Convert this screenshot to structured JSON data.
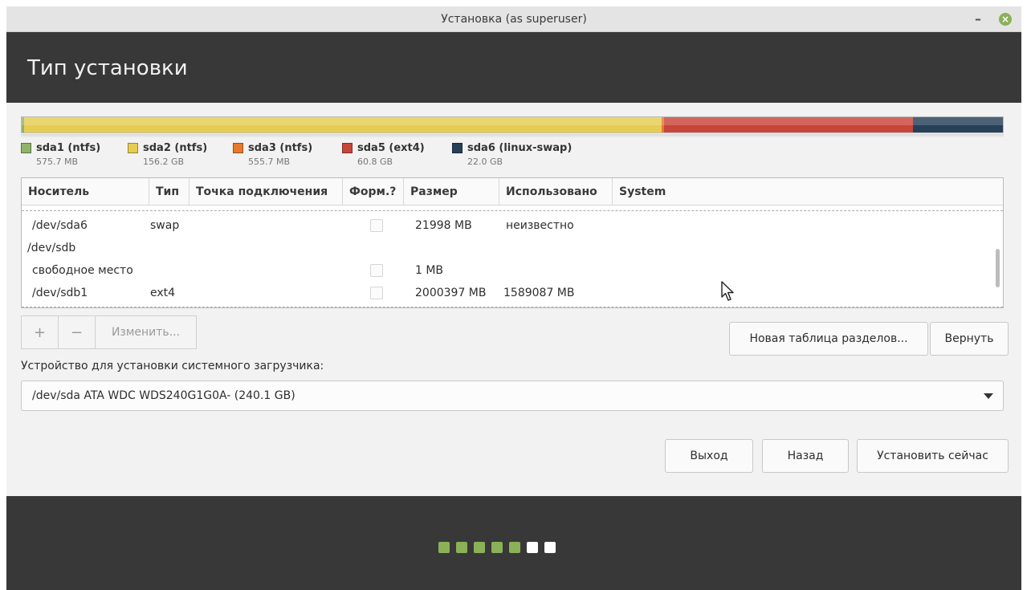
{
  "window": {
    "title": "Установка (as superuser)",
    "minimize_glyph": "–",
    "close_glyph": "×"
  },
  "header": {
    "title": "Тип установки"
  },
  "partition_bar": [
    {
      "id": "sda1",
      "fraction": 0.0024,
      "color": "#8fb36a"
    },
    {
      "id": "sda2",
      "fraction": 0.6502,
      "color": "#e6cd52"
    },
    {
      "id": "sda3",
      "fraction": 0.0023,
      "color": "#e8792c"
    },
    {
      "id": "sda5",
      "fraction": 0.2531,
      "color": "#c8453a"
    },
    {
      "id": "sda6",
      "fraction": 0.092,
      "color": "#26405a"
    }
  ],
  "legend": [
    {
      "name": "sda1 (ntfs)",
      "size": "575.7 MB",
      "color": "#8fb36a"
    },
    {
      "name": "sda2 (ntfs)",
      "size": "156.2 GB",
      "color": "#e6cd52"
    },
    {
      "name": "sda3 (ntfs)",
      "size": "555.7 MB",
      "color": "#e8792c"
    },
    {
      "name": "sda5 (ext4)",
      "size": "60.8 GB",
      "color": "#c8453a"
    },
    {
      "name": "sda6 (linux-swap)",
      "size": "22.0 GB",
      "color": "#26405a"
    }
  ],
  "table": {
    "columns": [
      "Носитель",
      "Тип",
      "Точка подключения",
      "Форм.?",
      "Размер",
      "Использовано",
      "System"
    ],
    "rows": [
      {
        "device": "/dev/sda6",
        "type": "swap",
        "mount": "",
        "format": false,
        "size": "21998 MB",
        "used": "неизвестно",
        "system": ""
      },
      {
        "device": "/dev/sdb",
        "type": "",
        "mount": "",
        "format": null,
        "size": "",
        "used": "",
        "system": ""
      },
      {
        "device": "свободное место",
        "type": "",
        "mount": "",
        "format": false,
        "size": "1 MB",
        "used": "",
        "system": ""
      },
      {
        "device": "/dev/sdb1",
        "type": "ext4",
        "mount": "",
        "format": false,
        "size": "2000397 MB",
        "used": "1589087 MB",
        "system": ""
      }
    ]
  },
  "toolbar": {
    "add_label": "+",
    "remove_label": "−",
    "change_label": "Изменить...",
    "new_table_label": "Новая таблица разделов...",
    "revert_label": "Вернуть"
  },
  "bootloader": {
    "label": "Устройство для установки системного загрузчика:",
    "value": "/dev/sda   ATA WDC WDS240G1G0A- (240.1 GB)"
  },
  "actions": {
    "quit_label": "Выход",
    "back_label": "Назад",
    "install_label": "Установить сейчас"
  },
  "progress": {
    "total_steps": 7,
    "completed_steps": 5,
    "done_color": "#8bb158",
    "todo_color": "#ffffff"
  }
}
